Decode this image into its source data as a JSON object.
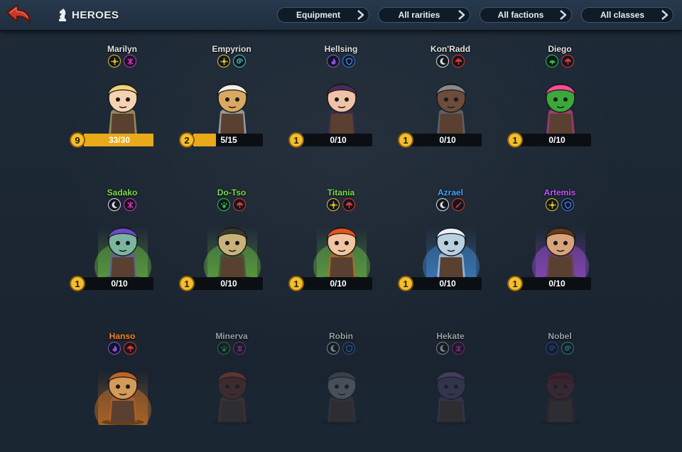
{
  "header": {
    "title": "HEROES",
    "filters": [
      {
        "label": "Equipment"
      },
      {
        "label": "All rarities"
      },
      {
        "label": "All factions"
      },
      {
        "label": "All classes"
      }
    ]
  },
  "colors": {
    "common": "#e6e6e6",
    "uncommon": "#7ee04a",
    "rare": "#4aa6ff",
    "epic": "#c05cff",
    "legendary": "#ff8a1f",
    "progress_fill": "#e9a919"
  },
  "heroes": [
    {
      "name": "Marilyn",
      "rarity": "common",
      "badges": [
        "yellow-sun-icon",
        "magenta-rune-icon"
      ],
      "level": "9",
      "count": "33/30",
      "progress": 1.0
    },
    {
      "name": "Empyrion",
      "rarity": "common",
      "badges": [
        "yellow-sun-icon",
        "teal-spiral-icon"
      ],
      "level": "2",
      "count": "5/15",
      "progress": 0.33
    },
    {
      "name": "Hellsing",
      "rarity": "common",
      "badges": [
        "purple-flame-icon",
        "blue-shield-icon"
      ],
      "level": "1",
      "count": "0/10",
      "progress": 0
    },
    {
      "name": "Kon'Radd",
      "rarity": "common",
      "badges": [
        "white-moon-icon",
        "red-axe-icon"
      ],
      "level": "1",
      "count": "0/10",
      "progress": 0
    },
    {
      "name": "Diego",
      "rarity": "common",
      "badges": [
        "green-helmet-icon",
        "red-axe-icon"
      ],
      "level": "1",
      "count": "0/10",
      "progress": 0
    },
    {
      "name": "Sadako",
      "rarity": "uncommon",
      "badges": [
        "white-moon-icon",
        "magenta-rune-icon"
      ],
      "level": "1",
      "count": "0/10",
      "progress": 0
    },
    {
      "name": "Do-Tso",
      "rarity": "uncommon",
      "badges": [
        "green-paw-icon",
        "red-axe-icon"
      ],
      "level": "1",
      "count": "0/10",
      "progress": 0
    },
    {
      "name": "Titania",
      "rarity": "uncommon",
      "badges": [
        "yellow-sun-icon",
        "red-axe-icon"
      ],
      "level": "1",
      "count": "0/10",
      "progress": 0
    },
    {
      "name": "Azrael",
      "rarity": "rare",
      "badges": [
        "white-moon-icon",
        "red-sword-icon"
      ],
      "level": "1",
      "count": "0/10",
      "progress": 0
    },
    {
      "name": "Artemis",
      "rarity": "epic",
      "badges": [
        "yellow-sun-icon",
        "blue-shield-icon"
      ],
      "level": "1",
      "count": "0/10",
      "progress": 0
    },
    {
      "name": "Hanso",
      "rarity": "legendary",
      "badges": [
        "purple-flame-icon",
        "red-axe-icon"
      ],
      "level": "",
      "count": "",
      "progress": 0,
      "dimmed": false
    },
    {
      "name": "Minerva",
      "rarity": "common",
      "badges": [
        "green-paw-icon",
        "magenta-rune-icon"
      ],
      "dimmed": true
    },
    {
      "name": "Robin",
      "rarity": "common",
      "badges": [
        "white-moon-icon",
        "blue-shield-icon"
      ],
      "dimmed": true
    },
    {
      "name": "Hekate",
      "rarity": "common",
      "badges": [
        "white-moon-icon",
        "magenta-rune-icon"
      ],
      "dimmed": true
    },
    {
      "name": "Nobel",
      "rarity": "common",
      "badges": [
        "blue-spiral-icon",
        "teal-spiral-icon"
      ],
      "dimmed": true
    }
  ]
}
